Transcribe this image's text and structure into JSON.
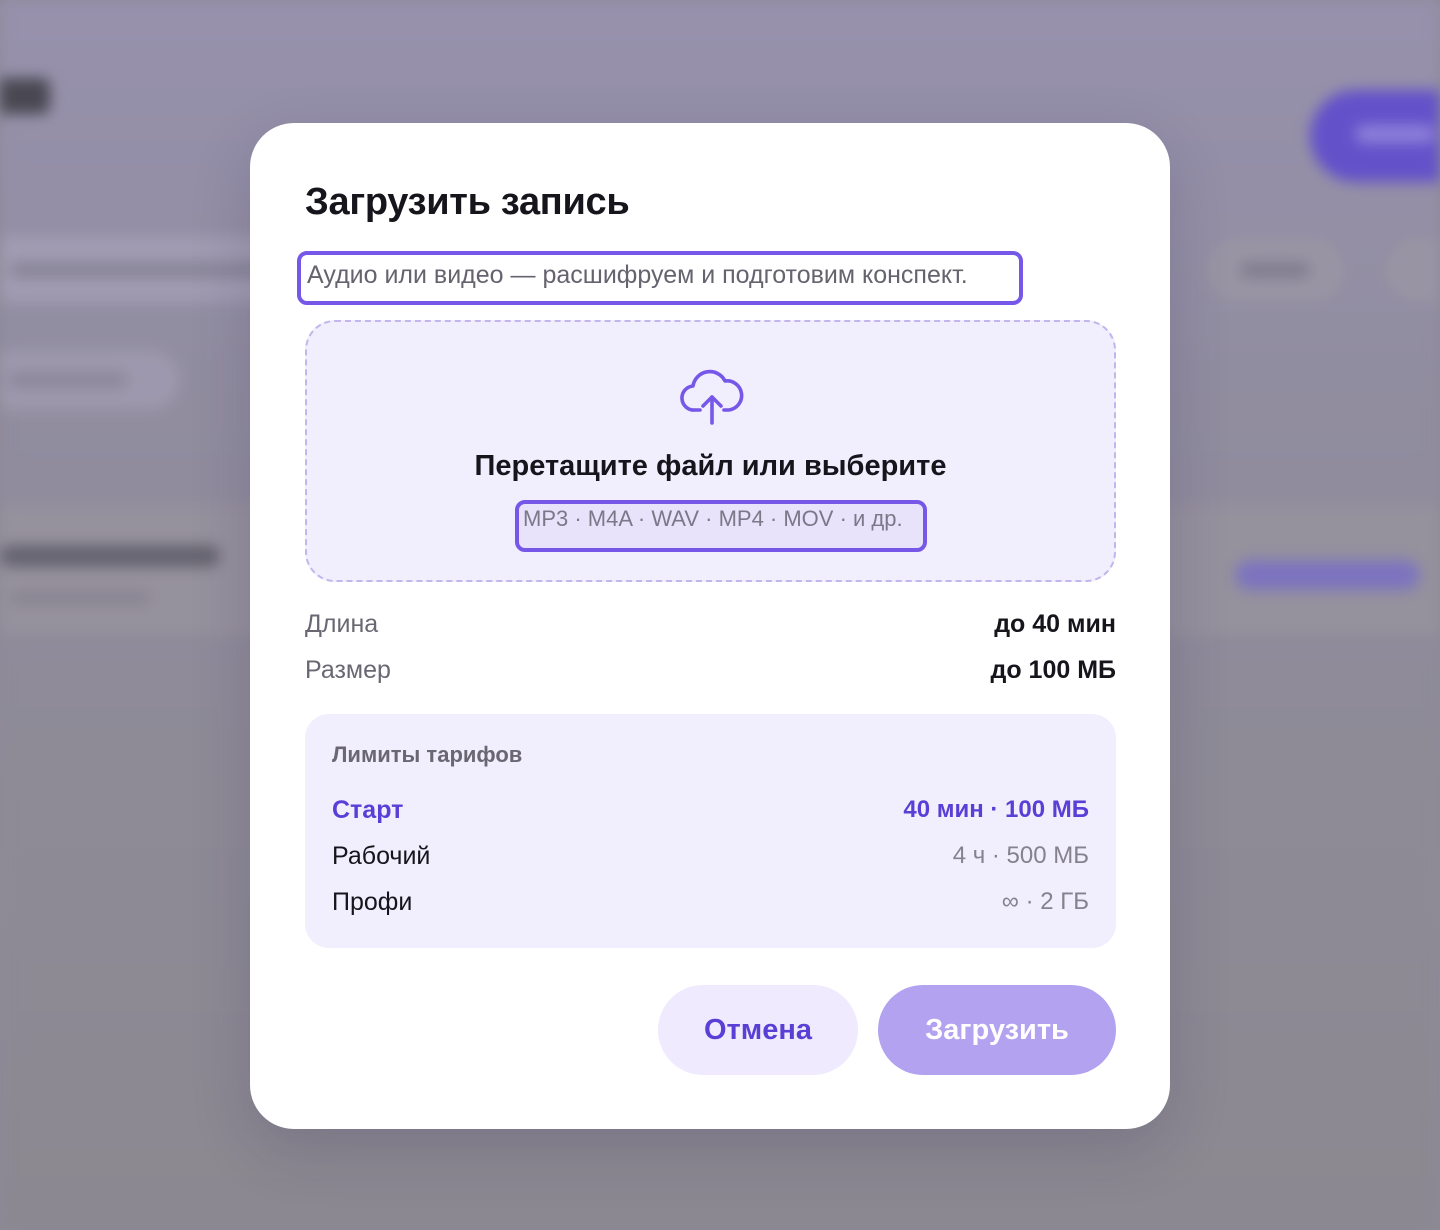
{
  "dialog": {
    "title": "Загрузить запись",
    "subtitle": "Аудио или видео — расшифруем и подготовим конспект."
  },
  "dropzone": {
    "icon": "cloud-upload-icon",
    "title": "Перетащите файл или выберите",
    "formats": "MP3 · M4A · WAV · MP4 · MOV · и др."
  },
  "specs": [
    {
      "label": "Длина",
      "value": "до 40 мин"
    },
    {
      "label": "Размер",
      "value": "до 100 МБ"
    }
  ],
  "tariffs": {
    "heading": "Лимиты тарифов",
    "items": [
      {
        "name": "Старт",
        "limit": "40 мин · 100 МБ",
        "current": true
      },
      {
        "name": "Рабочий",
        "limit": "4 ч · 500 МБ",
        "current": false
      },
      {
        "name": "Профи",
        "limit": "∞ · 2 ГБ",
        "current": false
      }
    ]
  },
  "buttons": {
    "cancel": "Отмена",
    "upload": "Загрузить",
    "upload_disabled": true
  },
  "colors": {
    "accent": "#5a3fd6",
    "highlight_border": "#7657e8",
    "dropzone_bg": "#f1eefd",
    "upload_button_bg": "#b3a2f0"
  }
}
